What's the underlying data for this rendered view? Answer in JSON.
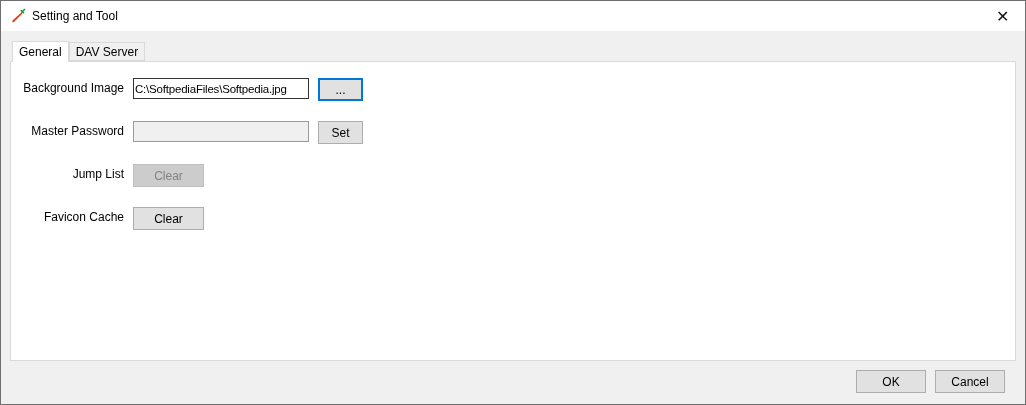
{
  "window": {
    "title": "Setting and Tool",
    "close": "✕"
  },
  "tabs": [
    {
      "label": "General",
      "selected": true
    },
    {
      "label": "DAV Server",
      "selected": false
    }
  ],
  "rows": [
    {
      "kind": "field",
      "label": "Background Image",
      "value": "C:\\SoftpediaFiles\\Softpedia.jpg",
      "field_disabled": false,
      "button": "...",
      "button_disabled": false,
      "focused": true
    },
    {
      "kind": "field",
      "label": "Master Password",
      "value": "",
      "field_disabled": true,
      "button": "Set",
      "button_disabled": false,
      "focused": false
    },
    {
      "kind": "button",
      "label": "Jump List",
      "button": "Clear",
      "button_disabled": true,
      "focused": false
    },
    {
      "kind": "button",
      "label": "Favicon Cache",
      "button": "Clear",
      "button_disabled": false,
      "focused": false
    }
  ],
  "buttons": [
    "OK",
    "Cancel"
  ]
}
